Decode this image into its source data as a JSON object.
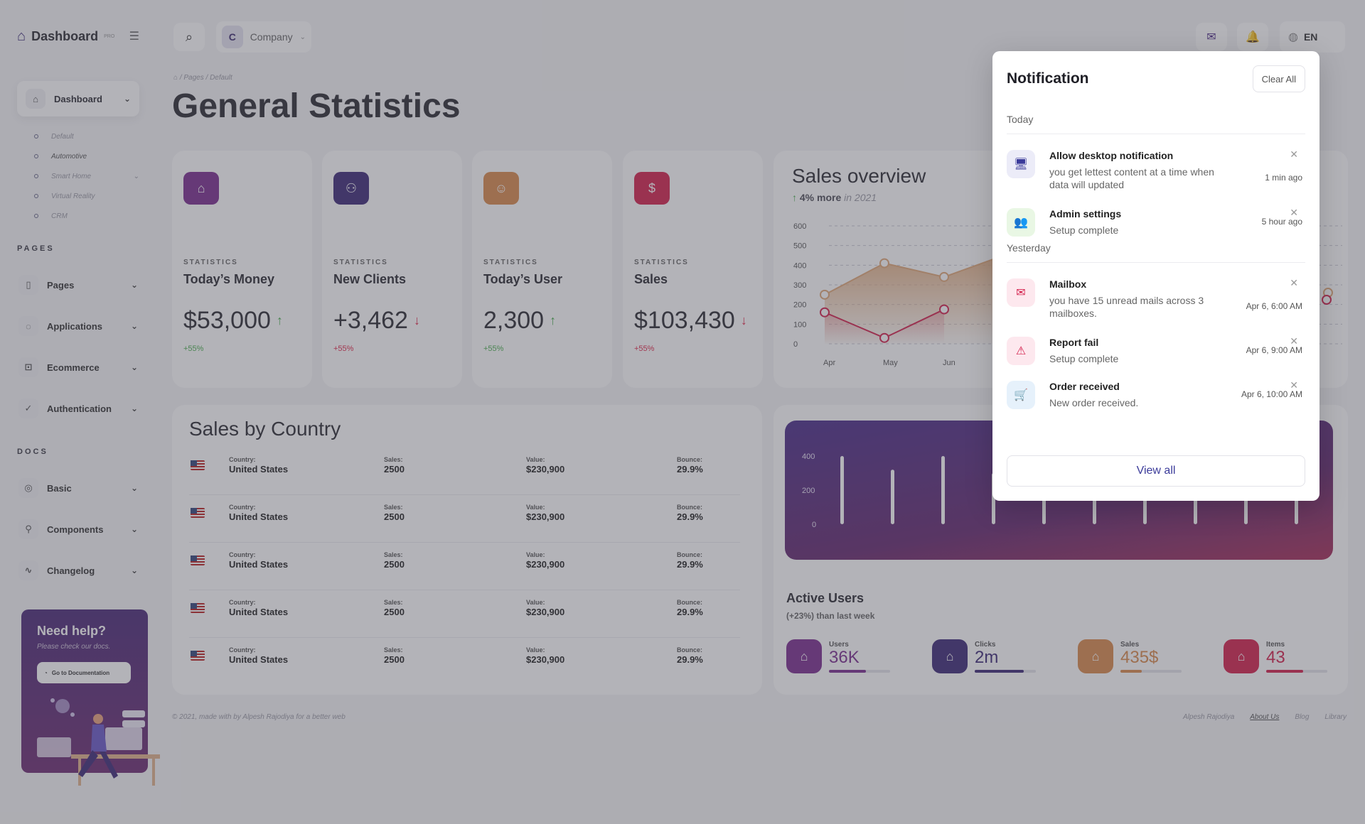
{
  "brand": {
    "name": "Dashboard",
    "badge": "PRO"
  },
  "sidebar": {
    "main_item": "Dashboard",
    "sub_items": [
      "Default",
      "Automotive",
      "Smart Home",
      "Virtual Reality",
      "CRM"
    ],
    "pages_label": "PAGES",
    "pages_items": [
      "Pages",
      "Applications",
      "Ecommerce",
      "Authentication"
    ],
    "docs_label": "DOCS",
    "docs_items": [
      "Basic",
      "Components",
      "Changelog"
    ],
    "help": {
      "title": "Need help?",
      "text": "Please check our docs.",
      "button": "Go to Documentation"
    }
  },
  "topbar": {
    "company_initial": "C",
    "company": "Company",
    "language": "EN"
  },
  "header": {
    "breadcrumb": "/  Pages  /  Default",
    "title": "General Statistics"
  },
  "stats": [
    {
      "label": "STATISTICS",
      "title": "Today’s Money",
      "value": "$53,000",
      "trend": "up",
      "change": "+55%",
      "color": "#7b2d8f"
    },
    {
      "label": "STATISTICS",
      "title": "New Clients",
      "value": "+3,462",
      "trend": "down",
      "change": "+55%",
      "color": "#3d2a78"
    },
    {
      "label": "STATISTICS",
      "title": "Today’s User",
      "value": "2,300",
      "trend": "up",
      "change": "+55%",
      "color": "#d98a4c"
    },
    {
      "label": "STATISTICS",
      "title": "Sales",
      "value": "$103,430",
      "trend": "down",
      "change": "+55%",
      "color": "#d4214d"
    }
  ],
  "sales_overview": {
    "title": "Sales overview",
    "more": "4% more",
    "suffix": "in 2021",
    "chart_data": {
      "type": "area",
      "categories": [
        "Apr",
        "May",
        "Jun"
      ],
      "ylim": [
        0,
        600
      ],
      "yticks": [
        0,
        100,
        200,
        300,
        400,
        500,
        600
      ],
      "series": [
        {
          "values": [
            250,
            410,
            340,
            450
          ],
          "color": "#e0a878"
        },
        {
          "values": [
            160,
            30,
            175
          ],
          "color": "#d4214d"
        }
      ]
    }
  },
  "country": {
    "title": "Sales by Country",
    "keys": {
      "country": "Country:",
      "sales": "Sales:",
      "value": "Value:",
      "bounce": "Bounce:"
    },
    "rows": [
      {
        "country": "United States",
        "sales": "2500",
        "value": "$230,900",
        "bounce": "29.9%"
      },
      {
        "country": "United States",
        "sales": "2500",
        "value": "$230,900",
        "bounce": "29.9%"
      },
      {
        "country": "United States",
        "sales": "2500",
        "value": "$230,900",
        "bounce": "29.9%"
      },
      {
        "country": "United States",
        "sales": "2500",
        "value": "$230,900",
        "bounce": "29.9%"
      },
      {
        "country": "United States",
        "sales": "2500",
        "value": "$230,900",
        "bounce": "29.9%"
      }
    ]
  },
  "active_users": {
    "title": "Active Users",
    "subtitle": "(+23%) than last week",
    "chart_data": {
      "type": "bar",
      "yticks": [
        0,
        200,
        400
      ],
      "ylim": [
        0,
        400
      ],
      "values": [
        400,
        320,
        400,
        300,
        270,
        250,
        260,
        300,
        280,
        300
      ]
    },
    "metrics": [
      {
        "label": "Users",
        "value": "36K",
        "progress": 0.6,
        "color": "#7b2d8f"
      },
      {
        "label": "Clicks",
        "value": "2m",
        "progress": 0.8,
        "color": "#3d2a78"
      },
      {
        "label": "Sales",
        "value": "435$",
        "progress": 0.35,
        "color": "#d98a4c"
      },
      {
        "label": "Items",
        "value": "43",
        "progress": 0.6,
        "color": "#d4214d"
      }
    ]
  },
  "footer": {
    "left": "© 2021, made with by Alpesh Rajodiya for a better web",
    "links": [
      "Alpesh Rajodiya",
      "About Us",
      "Blog",
      "Library"
    ]
  },
  "notifications": {
    "title": "Notification",
    "clear": "Clear All",
    "groups": [
      {
        "label": "Today",
        "items": [
          {
            "icon": "monitor-icon",
            "glyph": "🖥",
            "title": "Allow desktop notification",
            "desc": "you get lettest content at a time when data will updated",
            "time": "1 min ago",
            "bg": "#ececf8",
            "fg": "#3b3b9a"
          },
          {
            "icon": "users-icon",
            "glyph": "👥",
            "title": "Admin  settings",
            "desc": "Setup complete",
            "time": "5 hour ago",
            "bg": "#e9f7e4",
            "fg": "#4caf50"
          }
        ]
      },
      {
        "label": "Yesterday",
        "items": [
          {
            "icon": "mail-icon",
            "glyph": "✉",
            "title": "Mailbox",
            "desc": "you have 15 unread mails across 3 mailboxes.",
            "time": "Apr 6, 6:00 AM",
            "bg": "#fde8ee",
            "fg": "#d4214d"
          },
          {
            "icon": "warning-icon",
            "glyph": "⚠",
            "title": "Report fail",
            "desc": "Setup complete",
            "time": "Apr 6, 9:00 AM",
            "bg": "#fde8ee",
            "fg": "#d4214d"
          },
          {
            "icon": "cart-icon",
            "glyph": "🛒",
            "title": "Order received",
            "desc": "New order received.",
            "time": "Apr 6, 10:00 AM",
            "bg": "#e6f1fb",
            "fg": "#2a78c4"
          }
        ]
      }
    ],
    "view_all": "View all"
  }
}
